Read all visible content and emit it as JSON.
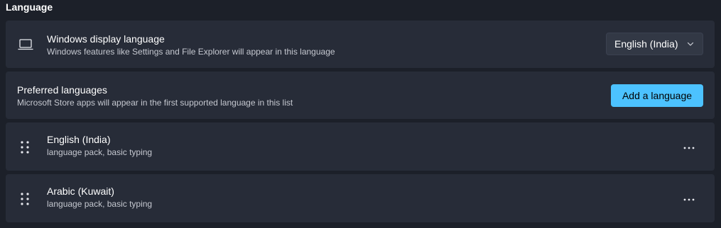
{
  "section": {
    "title": "Language"
  },
  "display_language": {
    "icon": "laptop-icon",
    "title": "Windows display language",
    "description": "Windows features like Settings and File Explorer will appear in this language",
    "selected": "English (India)"
  },
  "preferred": {
    "title": "Preferred languages",
    "description": "Microsoft Store apps will appear in the first supported language in this list",
    "add_button": "Add a language"
  },
  "languages": [
    {
      "name": "English (India)",
      "features": "language pack, basic typing"
    },
    {
      "name": "Arabic (Kuwait)",
      "features": "language pack, basic typing"
    }
  ],
  "colors": {
    "background": "#1c2029",
    "card": "#272c38",
    "accent": "#4cc2ff"
  }
}
